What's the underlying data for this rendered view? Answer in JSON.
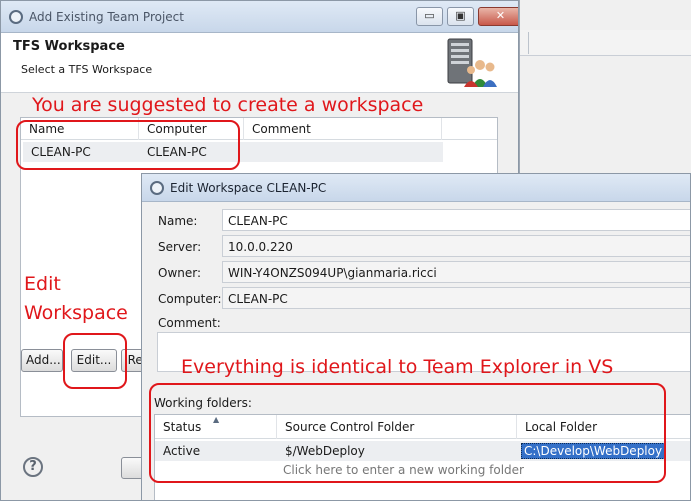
{
  "colors": {
    "annotation": "#e0171b",
    "selection": "#3470c8"
  },
  "dialog_add": {
    "title": "Add Existing Team Project",
    "controls": {
      "minimize": "▭",
      "maximize": "▣",
      "close": "✕"
    },
    "header_title": "TFS Workspace",
    "header_subtitle": "Select a TFS Workspace",
    "columns": [
      "Name",
      "Computer",
      "Comment"
    ],
    "rows": [
      {
        "name": "CLEAN-PC",
        "computer": "CLEAN-PC",
        "comment": ""
      }
    ],
    "buttons": {
      "add": "Add...",
      "edit": "Edit...",
      "remove": "Rem"
    },
    "help_icon": "?"
  },
  "dialog_edit": {
    "title": "Edit Workspace CLEAN-PC",
    "fields": {
      "name_label": "Name:",
      "name_value": "CLEAN-PC",
      "server_label": "Server:",
      "server_value": "10.0.0.220",
      "owner_label": "Owner:",
      "owner_value": "WIN-Y4ONZS094UP\\gianmaria.ricci",
      "computer_label": "Computer:",
      "computer_value": "CLEAN-PC",
      "comment_label": "Comment:"
    },
    "working_folders_label": "Working folders:",
    "columns": [
      "Status",
      "Source Control Folder",
      "Local Folder"
    ],
    "rows": [
      {
        "status": "Active",
        "source": "$/WebDeploy",
        "local": "C:\\Develop\\WebDeploy"
      }
    ],
    "new_row_hint": "Click here to enter a new working folder"
  },
  "annotations": {
    "suggest": "You are suggested to create a workspace",
    "edit_line1": "Edit",
    "edit_line2": "Workspace",
    "identical": "Everything is identical to Team Explorer in VS"
  }
}
